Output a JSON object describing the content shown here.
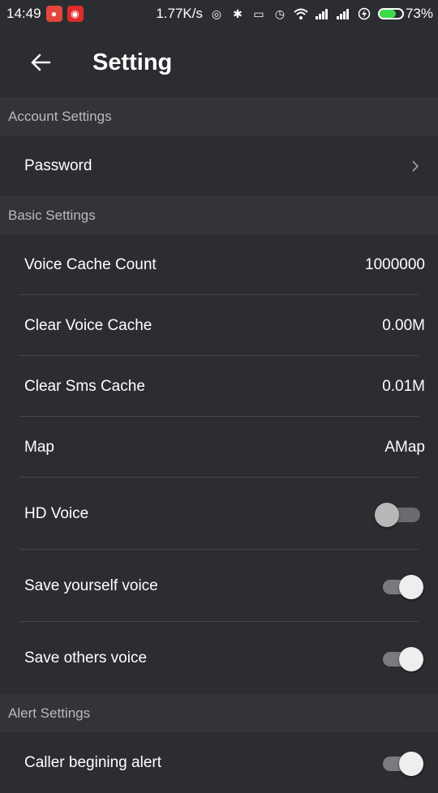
{
  "status_bar": {
    "time": "14:49",
    "network_speed": "1.77K/s",
    "battery_percent": "73%",
    "battery_level": 0.73,
    "battery_color": "#3ddc4b"
  },
  "header": {
    "title": "Setting",
    "back_icon": "arrow-left-icon"
  },
  "sections": {
    "account": {
      "title": "Account Settings",
      "password_label": "Password"
    },
    "basic": {
      "title": "Basic Settings",
      "voice_cache_count_label": "Voice Cache Count",
      "voice_cache_count_value": "1000000",
      "clear_voice_cache_label": "Clear Voice Cache",
      "clear_voice_cache_value": "0.00M",
      "clear_sms_cache_label": "Clear Sms Cache",
      "clear_sms_cache_value": "0.01M",
      "map_label": "Map",
      "map_value": "AMap",
      "hd_voice_label": "HD Voice",
      "hd_voice_on": false,
      "save_yourself_voice_label": "Save yourself voice",
      "save_yourself_voice_on": true,
      "save_others_voice_label": "Save others voice",
      "save_others_voice_on": true
    },
    "alert": {
      "title": "Alert Settings",
      "caller_alert_label": "Caller begining alert",
      "caller_alert_on": true
    }
  },
  "colors": {
    "background": "#2b2d31",
    "section_header_bg": "#323438",
    "section_header_text": "#b9babd",
    "divider": "#44464b"
  }
}
